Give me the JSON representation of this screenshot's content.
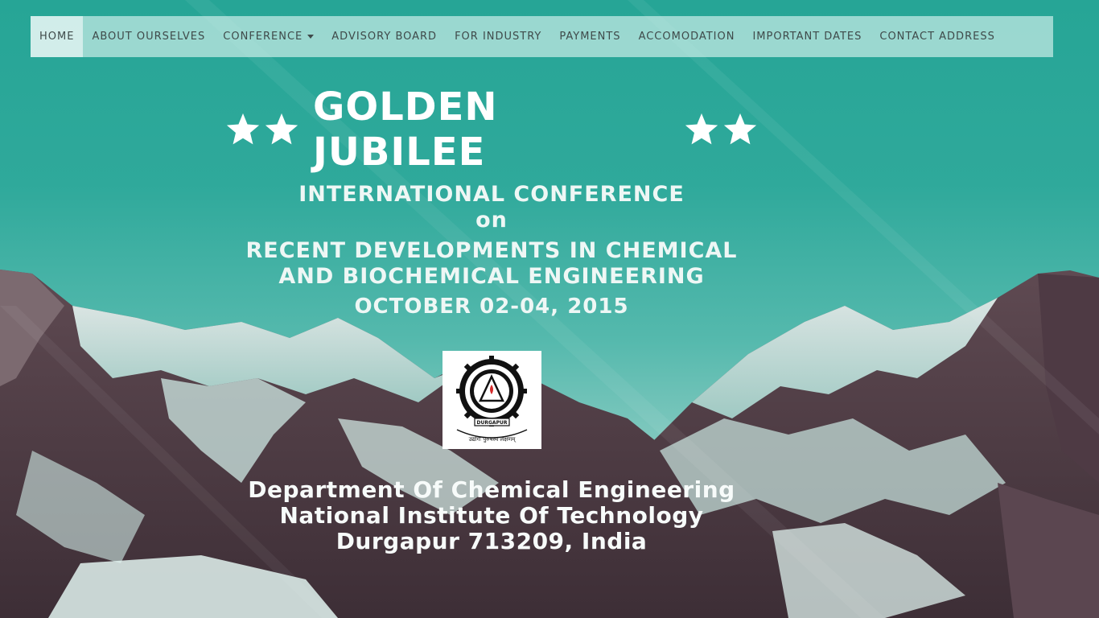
{
  "nav": {
    "items": [
      {
        "label": "HOME",
        "active": true
      },
      {
        "label": "ABOUT OURSELVES"
      },
      {
        "label": "CONFERENCE",
        "dropdown": true
      },
      {
        "label": "ADVISORY BOARD"
      },
      {
        "label": "FOR INDUSTRY"
      },
      {
        "label": "PAYMENTS"
      },
      {
        "label": "ACCOMODATION"
      },
      {
        "label": "IMPORTANT DATES"
      },
      {
        "label": "CONTACT ADDRESS"
      }
    ]
  },
  "hero": {
    "title": "GOLDEN JUBILEE",
    "subtitle_line1": "INTERNATIONAL CONFERENCE",
    "subtitle_line2": "on",
    "subtitle_line3": "RECENT DEVELOPMENTS IN CHEMICAL",
    "subtitle_line4": "AND BIOCHEMICAL ENGINEERING",
    "dates": "OCTOBER 02-04, 2015",
    "dept_line1": "Department Of Chemical Engineering",
    "dept_line2": "National Institute Of Technology",
    "dept_line3": "Durgapur 713209, India"
  },
  "logo": {
    "ring_text": "NATIONAL INSTITUTE OF TECHNOLOGY",
    "banner_text": "DURGAPUR",
    "motto": "उद्योगः पुरुषस्य लक्षणम्"
  },
  "colors": {
    "sky_top": "#26a596",
    "nav_bg": "rgba(200,235,230,0.72)",
    "nav_text": "#3f4a4a",
    "hero_text": "#ffffff"
  },
  "icons": {
    "star": "star-icon",
    "caret": "chevron-down-icon"
  }
}
